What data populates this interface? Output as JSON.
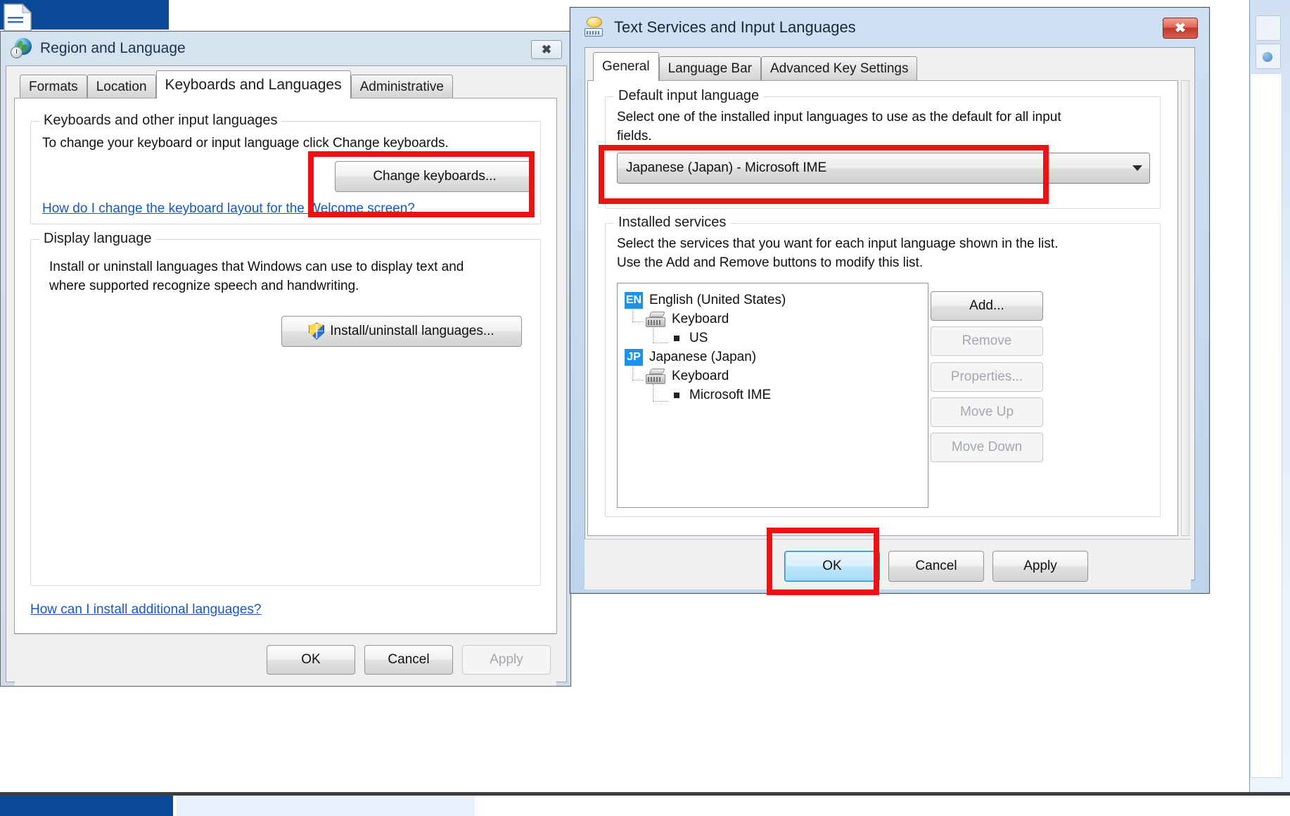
{
  "region_window": {
    "title": "Region and Language",
    "icon": "globe-clock-icon",
    "close_label": "✖",
    "tabs": [
      {
        "label": "Formats",
        "selected": false
      },
      {
        "label": "Location",
        "selected": false
      },
      {
        "label": "Keyboards and Languages",
        "selected": true
      },
      {
        "label": "Administrative",
        "selected": false
      }
    ],
    "keyboards_group": {
      "legend": "Keyboards and other input languages",
      "description": "To change your keyboard or input language click Change keyboards.",
      "change_keyboards_button": "Change keyboards...",
      "help_link": "How do I change the keyboard layout for the Welcome screen?"
    },
    "display_group": {
      "legend": "Display language",
      "description_line1": "Install or uninstall languages that Windows can use to display text and",
      "description_line2": "where supported recognize speech and handwriting.",
      "install_button": "Install/uninstall languages..."
    },
    "bottom_link": "How can I install additional languages?",
    "buttons": {
      "ok": "OK",
      "cancel": "Cancel",
      "apply": "Apply",
      "apply_disabled": true
    }
  },
  "text_services_window": {
    "title": "Text Services and Input Languages",
    "icon": "speech-keyboard-icon",
    "close_label": "✖",
    "tabs": [
      {
        "label": "General",
        "selected": true
      },
      {
        "label": "Language Bar",
        "selected": false
      },
      {
        "label": "Advanced Key Settings",
        "selected": false
      }
    ],
    "default_input_group": {
      "legend": "Default input language",
      "description_line1": "Select one of the installed input languages to use as the default for all input",
      "description_line2": "fields.",
      "selected_value": "Japanese (Japan) - Microsoft IME"
    },
    "installed_services_group": {
      "legend": "Installed services",
      "description_line1": "Select the services that you want for each input language shown in the list.",
      "description_line2": "Use the Add and Remove buttons to modify this list.",
      "tree": [
        {
          "level": 0,
          "badge": "EN",
          "label": "English (United States)",
          "icon": "lang-badge-icon"
        },
        {
          "level": 1,
          "badge": "",
          "label": "Keyboard",
          "icon": "keyboard-icon"
        },
        {
          "level": 2,
          "badge": "",
          "label": "US",
          "icon": "bullet-icon"
        },
        {
          "level": 0,
          "badge": "JP",
          "label": "Japanese (Japan)",
          "icon": "lang-badge-icon"
        },
        {
          "level": 1,
          "badge": "",
          "label": "Keyboard",
          "icon": "keyboard-icon"
        },
        {
          "level": 2,
          "badge": "",
          "label": "Microsoft IME",
          "icon": "bullet-icon"
        }
      ],
      "side_buttons": [
        {
          "label": "Add...",
          "disabled": false
        },
        {
          "label": "Remove",
          "disabled": true
        },
        {
          "label": "Properties...",
          "disabled": true
        },
        {
          "label": "Move Up",
          "disabled": true
        },
        {
          "label": "Move Down",
          "disabled": true
        }
      ]
    },
    "buttons": {
      "ok": "OK",
      "cancel": "Cancel",
      "apply": "Apply"
    }
  },
  "annotations": {
    "highlight_color": "#ee1111",
    "boxes": [
      {
        "name": "change-keyboards-highlight"
      },
      {
        "name": "default-input-language-highlight"
      },
      {
        "name": "ok-button-highlight"
      }
    ]
  }
}
